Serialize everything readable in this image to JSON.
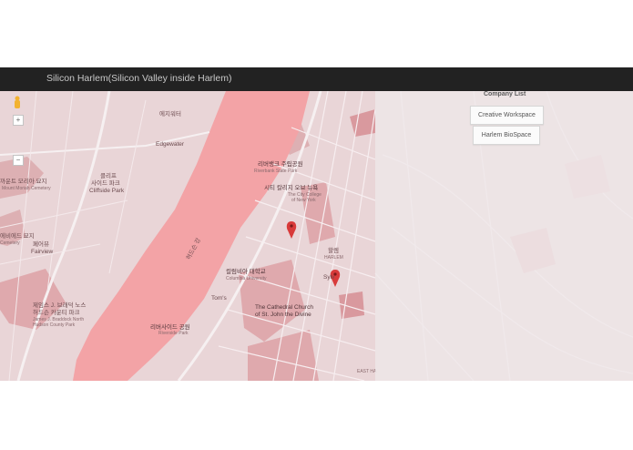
{
  "header": {
    "title": "Silicon Harlem(Silicon Valley inside Harlem)"
  },
  "company_list": {
    "title": "Company List",
    "companies": [
      "Creative Workspace",
      "Harlem BioSpace"
    ]
  },
  "map_controls": {
    "zoom_in": "+",
    "zoom_out": "−"
  },
  "map_labels": {
    "edgewater_kr": "에지워터",
    "edgewater": "Edgewater",
    "cliffside_kr": "클리프\n사이드 파크",
    "cliffside_kr1": "클리프",
    "cliffside_kr2": "사이드 파크",
    "cliffside": "Cliffside Park",
    "riverbank_kr": "리버뱅크 주립공원",
    "riverbank": "Riverbank State Park",
    "ccny_kr": "시티 칼리지 오브 뉴욕",
    "ccny": "The City College\nof New York",
    "ccny1": "The City College",
    "ccny2": "of New York",
    "harlem_kr": "할렘",
    "harlem": "HARLEM",
    "columbia_kr": "컬럼비아 대학교",
    "columbia": "Columbia University",
    "toms": "Tom's",
    "cathedral": "The Cathedral Church",
    "cathedral2": "of St. John the Divine",
    "sylvias": "Sylv",
    "riverside_kr": "리버사이드 공원",
    "riverside": "Riverside Park",
    "east_harlem": "EAST HA",
    "hudson_river": "허드슨 강",
    "fairview_kr": "페어뷰",
    "fairview": "Fairview",
    "cemetery_kr": "까운트 모리아 묘지",
    "cemetery": "Mount Moriah Cemetery",
    "james_park_kr": "제임스 J. 브래덕 노스",
    "james_park_kr2": "허드슨 카운티 파크",
    "james_park": "James J. Braddock North",
    "james_park2": "Hudson County Park",
    "ridgefield_kr": "에비에드 묘지",
    "ridgefield": "Cemetery"
  },
  "colors": {
    "header_bg": "#222222",
    "map_bg": "#e9d5d7",
    "river": "#f3a3a6",
    "park": "#e3b4b7",
    "marker": "#d83a3a"
  }
}
